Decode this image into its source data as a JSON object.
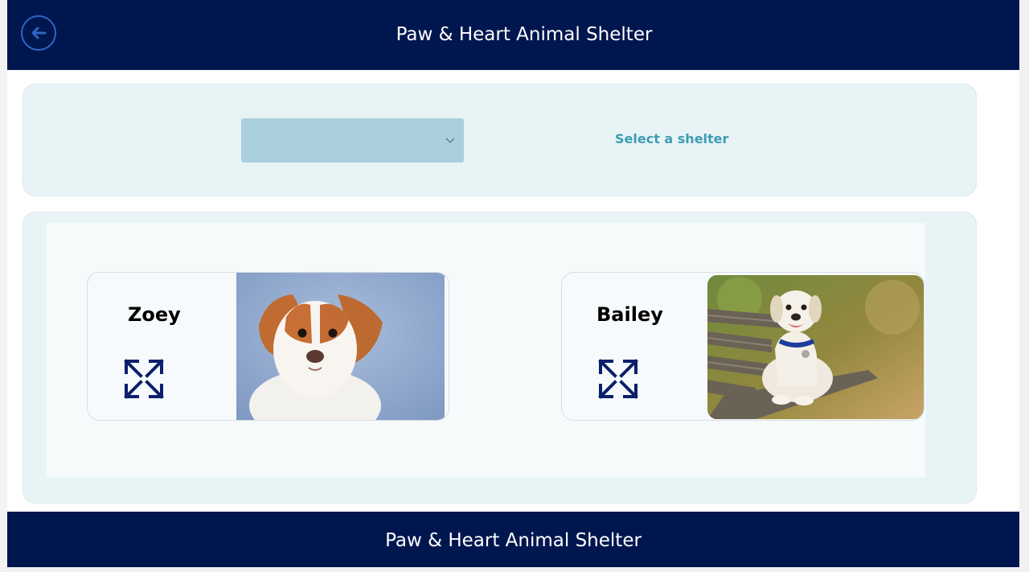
{
  "app": {
    "title": "Paw & Heart Animal Shelter"
  },
  "header": {
    "title": "Paw & Heart Animal Shelter",
    "back_icon": "arrow-left-icon"
  },
  "filter": {
    "dropdown_value": "",
    "select_label": "Select a shelter",
    "dropdown_icon": "chevron-down-icon"
  },
  "pets": [
    {
      "name": "Zoey",
      "expand_icon": "expand-icon",
      "photo": "dog-photo-zoey"
    },
    {
      "name": "Bailey",
      "expand_icon": "expand-icon",
      "photo": "dog-photo-bailey"
    }
  ],
  "footer": {
    "title": "Paw & Heart Animal Shelter"
  },
  "colors": {
    "header_bg": "#00164f",
    "panel_bg": "#e8f3f6",
    "dropdown_bg": "#aacfdd",
    "accent_text": "#3c9db2",
    "icon_navy": "#0b1f6b",
    "back_button_blue": "#2f65c8"
  }
}
